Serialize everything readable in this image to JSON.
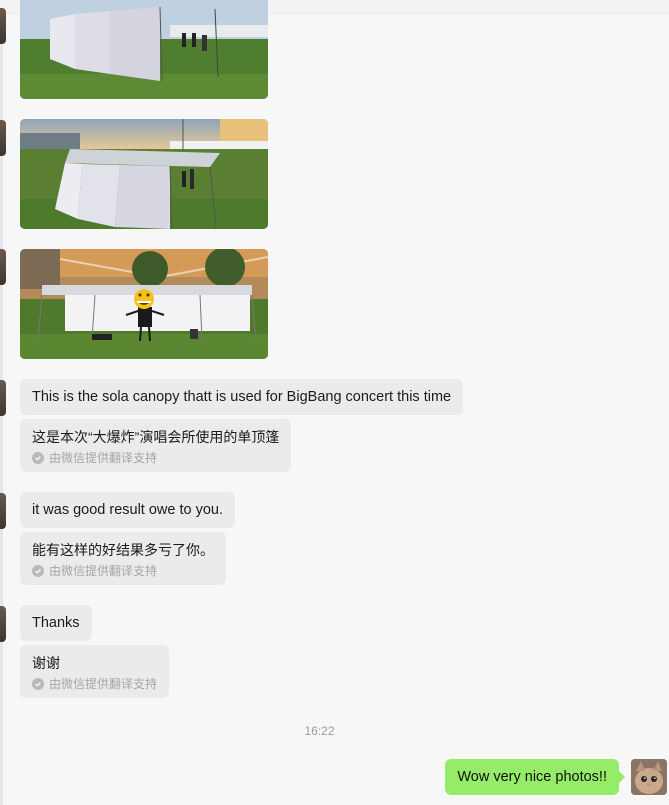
{
  "messages": {
    "m1": {
      "text": "This is the sola canopy thatt is used for BigBang concert this time"
    },
    "t1": {
      "text": "这是本次“大爆炸”演唱会所使用的单顶篷",
      "note": "由微信提供翻译支持"
    },
    "m2": {
      "text": "it was good result owe to you."
    },
    "t2": {
      "text": "能有这样的好结果多亏了你。",
      "note": "由微信提供翻译支持"
    },
    "m3": {
      "text": "Thanks"
    },
    "t3": {
      "text": "谢谢",
      "note": "由微信提供翻译支持"
    }
  },
  "timestamp": "16:22",
  "outgoing": {
    "text": "Wow very nice photos!!"
  },
  "colors": {
    "incoming_bubble": "#ebebed",
    "outgoing_bubble": "#95ec69",
    "background": "#f7f7f8"
  },
  "icons": [
    "check-circle-icon",
    "emoji-face-icon"
  ]
}
